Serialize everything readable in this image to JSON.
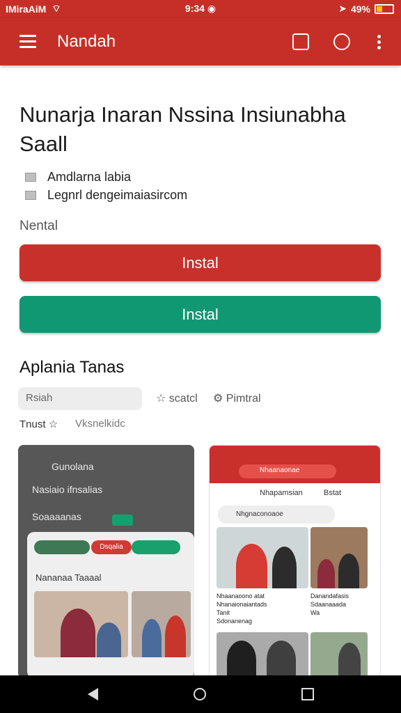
{
  "status": {
    "carrier": "IMiraAiM",
    "time": "9:34",
    "battery": "49%",
    "icons": [
      "wifi-icon",
      "notification-icon",
      "location-icon",
      "battery-icon"
    ]
  },
  "toolbar": {
    "title": "Nandah",
    "icons": [
      "menu-icon",
      "bookmark-icon",
      "search-icon",
      "more-vert-icon"
    ]
  },
  "page": {
    "title_line1": "Nunarja Inaran Nssina Insiunabha",
    "title_line2": "Saall",
    "meta1": "Amdlarna labia",
    "meta2": "Legnrl dengeimaiasircom",
    "section_label": "Nental",
    "install_red": "Instal",
    "install_green": "Instal",
    "apps_heading": "Aplania Tanas",
    "search_chip": "Rsiah",
    "tag1": "scatcl",
    "tag2": "Pimtral",
    "tab1": "Tnust",
    "tab2": "Vksnelkidc"
  },
  "screenshots": {
    "left": {
      "title": "Gunolana",
      "subtitle": "Nasiaio ifnsalias",
      "row": "Soaaaanas",
      "pill_label": "Dsqalia",
      "panel_title": "Nananaa Taaaal"
    },
    "right": {
      "search": "Nhaanaonae",
      "tab1": "Nhapamsian",
      "tab2": "Bstat",
      "card_title": "Nhgnaconoaoe",
      "cap1a": "Nhaanaoono atat",
      "cap1b": "Nhanaionaiantads",
      "cap1c": "Tanit",
      "cap1d": "Sdonanenag",
      "cap2a": "Danandafasis",
      "cap2b": "Sdaanaaada",
      "cap2c": "Wa"
    }
  },
  "colors": {
    "primary": "#c62f27",
    "green": "#109873"
  }
}
